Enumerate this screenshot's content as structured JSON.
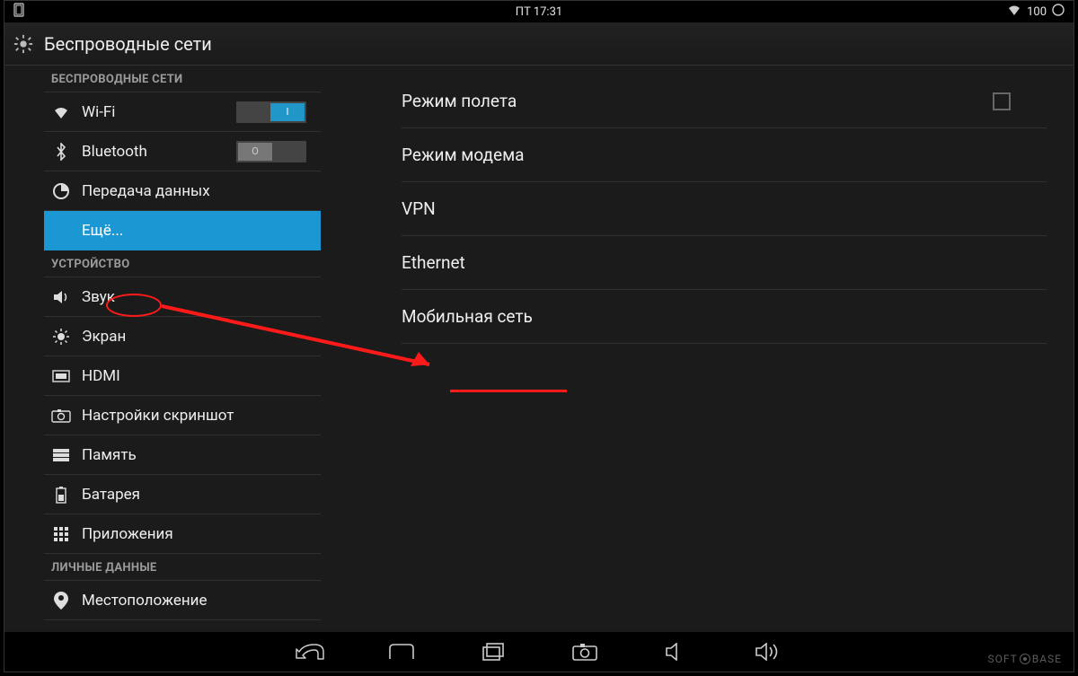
{
  "status": {
    "day": "ПТ",
    "time": "17:31",
    "battery": "100"
  },
  "header": {
    "title": "Беспроводные сети"
  },
  "sidebar": {
    "sections": {
      "wireless": "БЕСПРОВОДНЫЕ СЕТИ",
      "device": "УСТРОЙСТВО",
      "personal": "ЛИЧНЫЕ ДАННЫЕ"
    },
    "items": {
      "wifi": "Wi-Fi",
      "bluetooth": "Bluetooth",
      "data": "Передача данных",
      "more": "Ещё...",
      "sound": "Звук",
      "display": "Экран",
      "hdmi": "HDMI",
      "screenshot": "Настройки скриншот",
      "storage": "Память",
      "battery": "Батарея",
      "apps": "Приложения",
      "location": "Местоположение"
    },
    "toggle": {
      "on": "I",
      "off": "O"
    }
  },
  "main": {
    "airplane": "Режим полета",
    "tether": "Режим модема",
    "vpn": "VPN",
    "ethernet": "Ethernet",
    "mobile": "Мобильная сеть"
  },
  "watermark": {
    "left": "SOFT",
    "right": "BASE"
  }
}
